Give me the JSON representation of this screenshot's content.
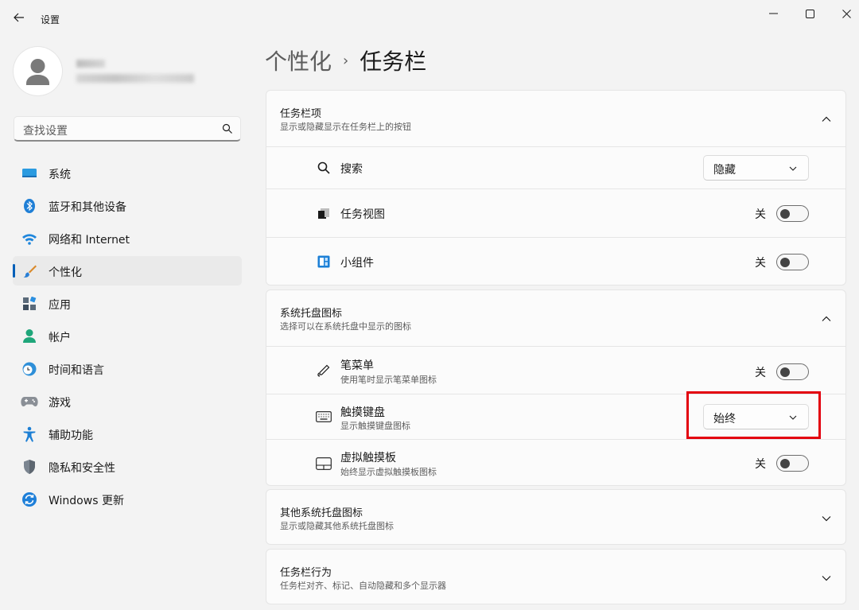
{
  "window": {
    "title": "设置",
    "back_icon": "back-arrow-icon",
    "controls": [
      "minimize-icon",
      "maximize-icon",
      "close-icon"
    ]
  },
  "sidebar": {
    "search_placeholder": "查找设置",
    "items": [
      {
        "label": "系统",
        "icon": "system-display-icon",
        "selected": false
      },
      {
        "label": "蓝牙和其他设备",
        "icon": "bluetooth-icon",
        "selected": false
      },
      {
        "label": "网络和 Internet",
        "icon": "wifi-icon",
        "selected": false
      },
      {
        "label": "个性化",
        "icon": "paintbrush-icon",
        "selected": true
      },
      {
        "label": "应用",
        "icon": "apps-icon",
        "selected": false
      },
      {
        "label": "帐户",
        "icon": "account-person-icon",
        "selected": false
      },
      {
        "label": "时间和语言",
        "icon": "clock-globe-icon",
        "selected": false
      },
      {
        "label": "游戏",
        "icon": "gamepad-icon",
        "selected": false
      },
      {
        "label": "辅助功能",
        "icon": "accessibility-icon",
        "selected": false
      },
      {
        "label": "隐私和安全性",
        "icon": "shield-icon",
        "selected": false
      },
      {
        "label": "Windows 更新",
        "icon": "windows-update-icon",
        "selected": false
      }
    ],
    "accent_color": "#005fb8"
  },
  "breadcrumb": {
    "parent": "个性化",
    "separator": "›",
    "current": "任务栏"
  },
  "sections": {
    "taskbar_items": {
      "title": "任务栏项",
      "subtitle": "显示或隐藏显示在任务栏上的按钮",
      "expanded": true,
      "rows": {
        "search": {
          "label": "搜索",
          "control": "dropdown",
          "value": "隐藏"
        },
        "task_view": {
          "label": "任务视图",
          "control": "toggle",
          "state_text": "关",
          "on": false
        },
        "widgets": {
          "label": "小组件",
          "control": "toggle",
          "state_text": "关",
          "on": false
        }
      }
    },
    "system_tray_icons": {
      "title": "系统托盘图标",
      "subtitle": "选择可以在系统托盘中显示的图标",
      "expanded": true,
      "rows": {
        "pen_menu": {
          "label": "笔菜单",
          "sub": "使用笔时显示笔菜单图标",
          "control": "toggle",
          "state_text": "关",
          "on": false
        },
        "touch_keyboard": {
          "label": "触摸键盘",
          "sub": "显示触摸键盘图标",
          "control": "dropdown",
          "value": "始终"
        },
        "virtual_touchpad": {
          "label": "虚拟触摸板",
          "sub": "始终显示虚拟触摸板图标",
          "control": "toggle",
          "state_text": "关",
          "on": false
        }
      }
    },
    "other_tray_icons": {
      "title": "其他系统托盘图标",
      "subtitle": "显示或隐藏其他系统托盘图标",
      "expanded": false
    },
    "taskbar_behaviors": {
      "title": "任务栏行为",
      "subtitle": "任务栏对齐、标记、自动隐藏和多个显示器",
      "expanded": false
    }
  },
  "annotation": {
    "highlight_color": "#e3000f",
    "target": "touch_keyboard dropdown"
  }
}
